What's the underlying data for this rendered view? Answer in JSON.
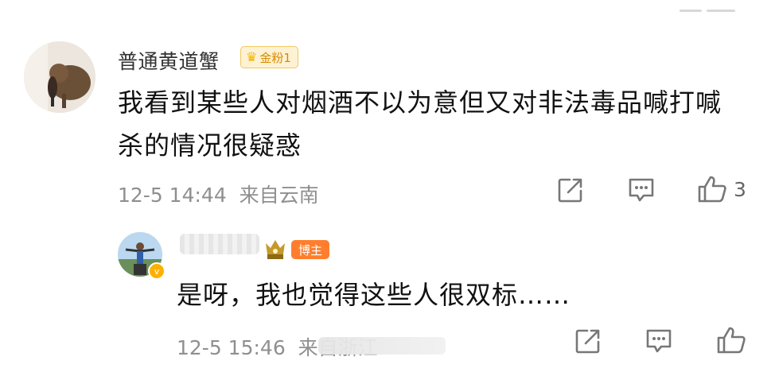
{
  "comment": {
    "username": "普通黄道蟹",
    "fan_badge": "金粉1",
    "content": "我看到某些人对烟酒不以为意但又对非法毒品喊打喊杀的情况很疑惑",
    "meta": "12-5 14:44  来自云南",
    "like_count": "3"
  },
  "reply": {
    "host_badge": "博主",
    "content": "是呀，我也觉得这些人很双标……",
    "meta": "12-5 15:46  来自浙江"
  },
  "icons": [
    "share-icon",
    "comment-icon",
    "like-icon"
  ]
}
